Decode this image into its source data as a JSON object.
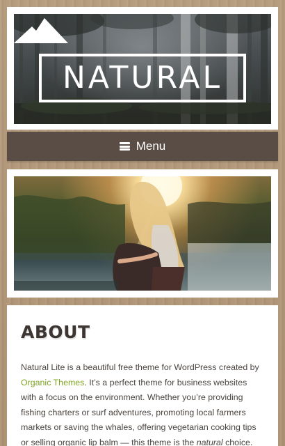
{
  "header": {
    "logo_text": "NATURAL",
    "menu_label": "Menu"
  },
  "about": {
    "title": "ABOUT",
    "text_before_link": "Natural Lite is a beautiful free theme for WordPress created by ",
    "link_text": "Organic Themes",
    "text_after_link": ". It’s a perfect theme for business websites with a focus on the environment. Whether you’re providing fishing charters or surf adventures, promoting local farmers markets or saving the whales, offering vegetarian cooking tips or selling organic lip balm — this theme is the ",
    "emphasis_text": "natural",
    "text_end": " choice."
  },
  "colors": {
    "menu_background": "#5a4d45",
    "link": "#7ea31f",
    "title": "#3c3532",
    "body_text": "#4a4541",
    "page_background": "#b49a7c"
  },
  "icons": {
    "logo_mark": "mountain-icon",
    "menu": "hamburger-icon"
  }
}
